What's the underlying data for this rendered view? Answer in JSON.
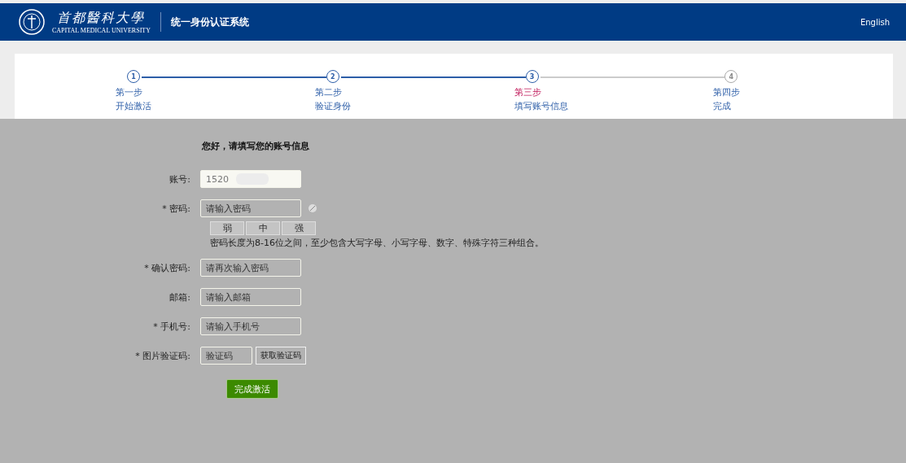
{
  "header": {
    "university_name": "首都醫科大學",
    "university_name_en": "CAPITAL MEDICAL UNIVERSITY",
    "system_title": "统一身份认证系统",
    "language_link": "English"
  },
  "steps": [
    {
      "number": "1",
      "title": "第一步",
      "subtitle": "开始激活",
      "selected": false,
      "done": true
    },
    {
      "number": "2",
      "title": "第二步",
      "subtitle": "验证身份",
      "selected": false,
      "done": true
    },
    {
      "number": "3",
      "title": "第三步",
      "subtitle": "填写账号信息",
      "selected": true,
      "done": true
    },
    {
      "number": "4",
      "title": "第四步",
      "subtitle": "完成",
      "selected": false,
      "done": false
    }
  ],
  "form": {
    "heading": "您好，请填写您的账号信息",
    "fields": [
      {
        "kind": "readonly",
        "label": "账号:",
        "required": false,
        "value": "1520"
      },
      {
        "kind": "password",
        "label": "密码:",
        "required": true,
        "placeholder": "请输入密码"
      },
      {
        "kind": "strength",
        "levels": [
          "弱",
          "中",
          "强"
        ],
        "hint": "密码长度为8-16位之间，至少包含大写字母、小写字母、数字、特殊字符三种组合。"
      },
      {
        "kind": "text",
        "label": "确认密码:",
        "required": true,
        "placeholder": "请再次输入密码"
      },
      {
        "kind": "text",
        "label": "邮箱:",
        "required": false,
        "placeholder": "请输入邮箱"
      },
      {
        "kind": "text",
        "label": "手机号:",
        "required": true,
        "placeholder": "请输入手机号"
      },
      {
        "kind": "captcha",
        "label": "图片验证码:",
        "required": true,
        "placeholder": "验证码",
        "captcha": "获取验证码"
      }
    ],
    "required_mark": "*",
    "submit": "完成激活"
  }
}
